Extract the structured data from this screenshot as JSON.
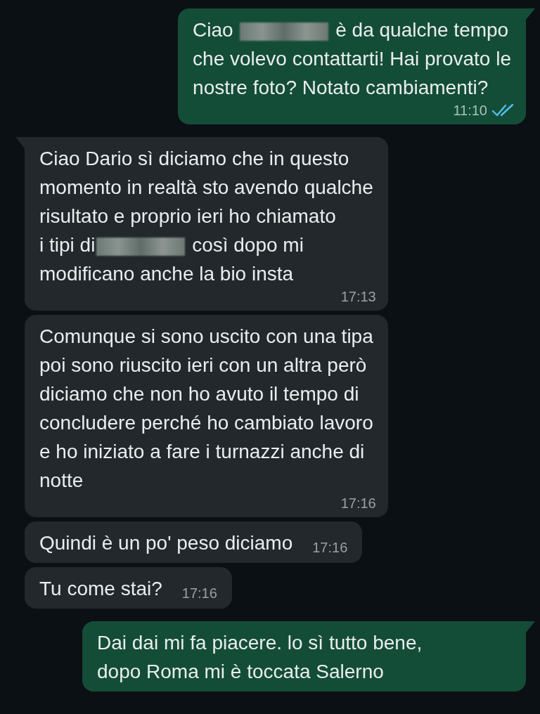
{
  "messages": [
    {
      "kind": "outgoing",
      "tail": true,
      "segments": [
        {
          "kind": "text",
          "text": "Ciao "
        },
        {
          "kind": "redacted"
        },
        {
          "kind": "text",
          "text": " è da qualche tempo\nche volevo contattarti! Hai provato le\nnostre foto? Notato cambiamenti?"
        }
      ],
      "time": "11:10",
      "read": true
    },
    {
      "kind": "incoming",
      "tail": true,
      "segments": [
        {
          "kind": "text",
          "text": "Ciao Dario sì diciamo che in questo\nmomento in realtà sto avendo qualche\nrisultato e proprio ieri ho chiamato\ni tipi di"
        },
        {
          "kind": "redacted"
        },
        {
          "kind": "text",
          "text": " così dopo mi\nmodificano anche la bio insta"
        }
      ],
      "time": "17:13"
    },
    {
      "kind": "incoming",
      "tail": false,
      "segments": [
        {
          "kind": "text",
          "text": "Comunque si sono uscito con una tipa\npoi sono riuscito ieri con un altra però\ndiciamo che non ho avuto il tempo di\nconcludere perché ho cambiato lavoro\ne ho iniziato a fare i turnazzi anche di\nnotte"
        }
      ],
      "time": "17:16"
    },
    {
      "kind": "incoming",
      "tail": false,
      "segments": [
        {
          "kind": "text",
          "text": "Quindi è un po' peso diciamo"
        }
      ],
      "time": "17:16"
    },
    {
      "kind": "incoming",
      "tail": false,
      "segments": [
        {
          "kind": "text",
          "text": "Tu come stai?"
        }
      ],
      "time": "17:16"
    },
    {
      "kind": "outgoing",
      "tail": true,
      "segments": [
        {
          "kind": "text",
          "text": "Dai dai mi fa piacere. lo sì tutto bene,\ndopo Roma mi è toccata Salerno"
        }
      ]
    }
  ]
}
